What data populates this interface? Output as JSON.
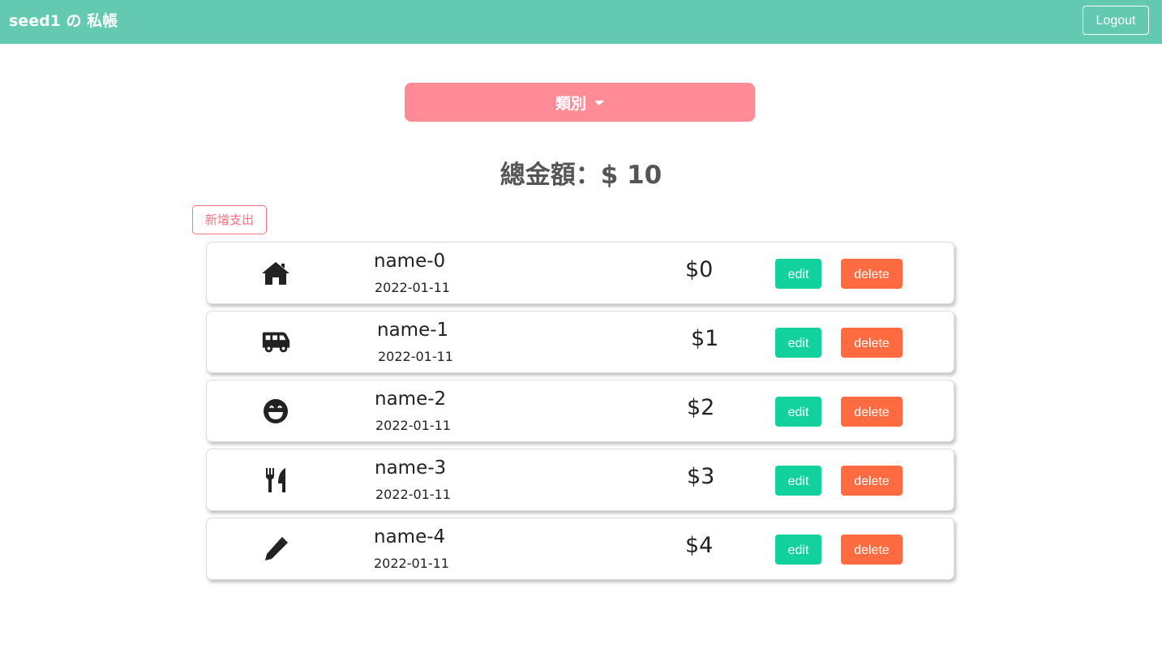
{
  "header": {
    "brand": "seed1 の 私帳",
    "logout_label": "Logout"
  },
  "filter": {
    "category_label": "類別"
  },
  "summary": {
    "total_text": "總金額：$ 10"
  },
  "actions": {
    "add_label": "新增支出"
  },
  "records": [
    {
      "icon": "home-icon",
      "name": "name-0",
      "date": "2022-01-11",
      "amount": "$0",
      "edit_label": "edit",
      "delete_label": "delete"
    },
    {
      "icon": "van-icon",
      "name": "name-1",
      "date": "2022-01-11",
      "amount": "$1",
      "edit_label": "edit",
      "delete_label": "delete"
    },
    {
      "icon": "grin-icon",
      "name": "name-2",
      "date": "2022-01-11",
      "amount": "$2",
      "edit_label": "edit",
      "delete_label": "delete"
    },
    {
      "icon": "utensils-icon",
      "name": "name-3",
      "date": "2022-01-11",
      "amount": "$3",
      "edit_label": "edit",
      "delete_label": "delete"
    },
    {
      "icon": "pen-icon",
      "name": "name-4",
      "date": "2022-01-11",
      "amount": "$4",
      "edit_label": "edit",
      "delete_label": "delete"
    }
  ],
  "colors": {
    "navbar": "#63c9b1",
    "category_button": "#ff8b96",
    "add_button": "#ff6f7d",
    "edit_button": "#12d19d",
    "delete_button": "#ff6b40"
  }
}
